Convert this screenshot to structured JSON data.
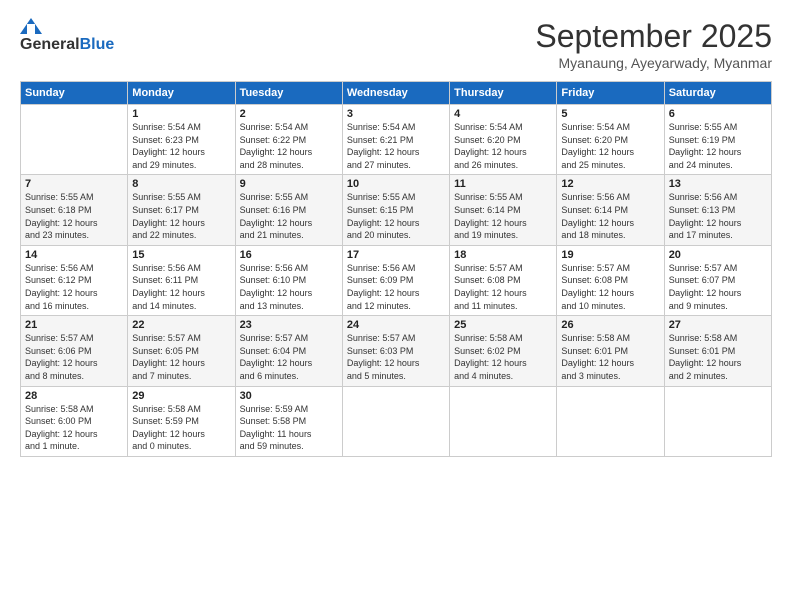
{
  "logo": {
    "general": "General",
    "blue": "Blue"
  },
  "title": "September 2025",
  "subtitle": "Myanaung, Ayeyarwady, Myanmar",
  "days_header": [
    "Sunday",
    "Monday",
    "Tuesday",
    "Wednesday",
    "Thursday",
    "Friday",
    "Saturday"
  ],
  "weeks": [
    [
      {
        "day": "",
        "info": ""
      },
      {
        "day": "1",
        "info": "Sunrise: 5:54 AM\nSunset: 6:23 PM\nDaylight: 12 hours\nand 29 minutes."
      },
      {
        "day": "2",
        "info": "Sunrise: 5:54 AM\nSunset: 6:22 PM\nDaylight: 12 hours\nand 28 minutes."
      },
      {
        "day": "3",
        "info": "Sunrise: 5:54 AM\nSunset: 6:21 PM\nDaylight: 12 hours\nand 27 minutes."
      },
      {
        "day": "4",
        "info": "Sunrise: 5:54 AM\nSunset: 6:20 PM\nDaylight: 12 hours\nand 26 minutes."
      },
      {
        "day": "5",
        "info": "Sunrise: 5:54 AM\nSunset: 6:20 PM\nDaylight: 12 hours\nand 25 minutes."
      },
      {
        "day": "6",
        "info": "Sunrise: 5:55 AM\nSunset: 6:19 PM\nDaylight: 12 hours\nand 24 minutes."
      }
    ],
    [
      {
        "day": "7",
        "info": "Sunrise: 5:55 AM\nSunset: 6:18 PM\nDaylight: 12 hours\nand 23 minutes."
      },
      {
        "day": "8",
        "info": "Sunrise: 5:55 AM\nSunset: 6:17 PM\nDaylight: 12 hours\nand 22 minutes."
      },
      {
        "day": "9",
        "info": "Sunrise: 5:55 AM\nSunset: 6:16 PM\nDaylight: 12 hours\nand 21 minutes."
      },
      {
        "day": "10",
        "info": "Sunrise: 5:55 AM\nSunset: 6:15 PM\nDaylight: 12 hours\nand 20 minutes."
      },
      {
        "day": "11",
        "info": "Sunrise: 5:55 AM\nSunset: 6:14 PM\nDaylight: 12 hours\nand 19 minutes."
      },
      {
        "day": "12",
        "info": "Sunrise: 5:56 AM\nSunset: 6:14 PM\nDaylight: 12 hours\nand 18 minutes."
      },
      {
        "day": "13",
        "info": "Sunrise: 5:56 AM\nSunset: 6:13 PM\nDaylight: 12 hours\nand 17 minutes."
      }
    ],
    [
      {
        "day": "14",
        "info": "Sunrise: 5:56 AM\nSunset: 6:12 PM\nDaylight: 12 hours\nand 16 minutes."
      },
      {
        "day": "15",
        "info": "Sunrise: 5:56 AM\nSunset: 6:11 PM\nDaylight: 12 hours\nand 14 minutes."
      },
      {
        "day": "16",
        "info": "Sunrise: 5:56 AM\nSunset: 6:10 PM\nDaylight: 12 hours\nand 13 minutes."
      },
      {
        "day": "17",
        "info": "Sunrise: 5:56 AM\nSunset: 6:09 PM\nDaylight: 12 hours\nand 12 minutes."
      },
      {
        "day": "18",
        "info": "Sunrise: 5:57 AM\nSunset: 6:08 PM\nDaylight: 12 hours\nand 11 minutes."
      },
      {
        "day": "19",
        "info": "Sunrise: 5:57 AM\nSunset: 6:08 PM\nDaylight: 12 hours\nand 10 minutes."
      },
      {
        "day": "20",
        "info": "Sunrise: 5:57 AM\nSunset: 6:07 PM\nDaylight: 12 hours\nand 9 minutes."
      }
    ],
    [
      {
        "day": "21",
        "info": "Sunrise: 5:57 AM\nSunset: 6:06 PM\nDaylight: 12 hours\nand 8 minutes."
      },
      {
        "day": "22",
        "info": "Sunrise: 5:57 AM\nSunset: 6:05 PM\nDaylight: 12 hours\nand 7 minutes."
      },
      {
        "day": "23",
        "info": "Sunrise: 5:57 AM\nSunset: 6:04 PM\nDaylight: 12 hours\nand 6 minutes."
      },
      {
        "day": "24",
        "info": "Sunrise: 5:57 AM\nSunset: 6:03 PM\nDaylight: 12 hours\nand 5 minutes."
      },
      {
        "day": "25",
        "info": "Sunrise: 5:58 AM\nSunset: 6:02 PM\nDaylight: 12 hours\nand 4 minutes."
      },
      {
        "day": "26",
        "info": "Sunrise: 5:58 AM\nSunset: 6:01 PM\nDaylight: 12 hours\nand 3 minutes."
      },
      {
        "day": "27",
        "info": "Sunrise: 5:58 AM\nSunset: 6:01 PM\nDaylight: 12 hours\nand 2 minutes."
      }
    ],
    [
      {
        "day": "28",
        "info": "Sunrise: 5:58 AM\nSunset: 6:00 PM\nDaylight: 12 hours\nand 1 minute."
      },
      {
        "day": "29",
        "info": "Sunrise: 5:58 AM\nSunset: 5:59 PM\nDaylight: 12 hours\nand 0 minutes."
      },
      {
        "day": "30",
        "info": "Sunrise: 5:59 AM\nSunset: 5:58 PM\nDaylight: 11 hours\nand 59 minutes."
      },
      {
        "day": "",
        "info": ""
      },
      {
        "day": "",
        "info": ""
      },
      {
        "day": "",
        "info": ""
      },
      {
        "day": "",
        "info": ""
      }
    ]
  ]
}
